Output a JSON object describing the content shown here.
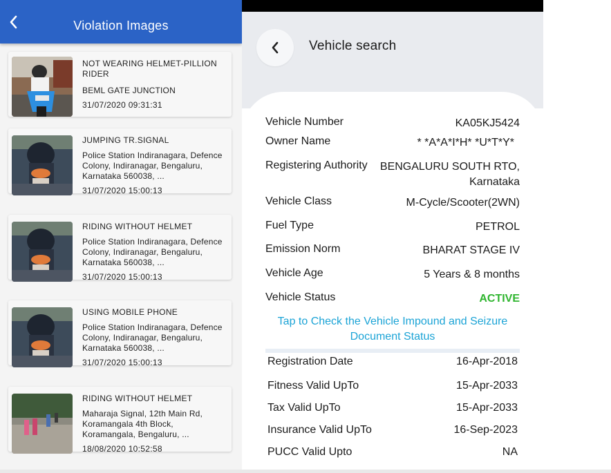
{
  "left_panel": {
    "title": "Violation Images",
    "violations": [
      {
        "type": "NOT WEARING HELMET-PILLION RIDER",
        "location": "BEML GATE JUNCTION",
        "time": "31/07/2020 09:31:31",
        "photo": "scooter-blue"
      },
      {
        "type": "JUMPING TR.SIGNAL",
        "location": "Police Station Indiranagara, Defence Colony, Indiranagar, Bengaluru, Karnataka 560038, ...",
        "time": "31/07/2020 15:00:13",
        "photo": "scooter-night"
      },
      {
        "type": "RIDING WITHOUT HELMET",
        "location": "Police Station Indiranagara, Defence Colony, Indiranagar, Bengaluru, Karnataka 560038, ...",
        "time": "31/07/2020 15:00:13",
        "photo": "scooter-night"
      },
      {
        "type": "USING MOBILE PHONE",
        "location": "Police Station Indiranagara, Defence Colony, Indiranagar, Bengaluru, Karnataka 560038, ...",
        "time": "31/07/2020 15:00:13",
        "photo": "scooter-night"
      },
      {
        "type": "RIDING WITHOUT HELMET",
        "location": "Maharaja Signal, 12th Main Rd, Koramangala 4th Block, Koramangala, Bengaluru, ...",
        "time": "18/08/2020 10:52:58",
        "photo": "street"
      }
    ]
  },
  "vehicle_search": {
    "title": "Vehicle search",
    "details": [
      {
        "label": "Vehicle Number",
        "value": "KA05KJ5424"
      },
      {
        "label": "Owner Name",
        "value": "*  *A*A*I*H*  *U*T*Y*"
      },
      {
        "label": "Registering Authority",
        "value_line1": "BENGALURU SOUTH  RTO,",
        "value_line2": "Karnataka"
      },
      {
        "label": "Vehicle Class",
        "value": "M-Cycle/Scooter(2WN)"
      },
      {
        "label": "Fuel Type",
        "value": "PETROL"
      },
      {
        "label": "Emission Norm",
        "value": "BHARAT STAGE IV"
      },
      {
        "label": "Vehicle Age",
        "value": "5 Years  & 8 months"
      },
      {
        "label": "Vehicle Status",
        "value": "ACTIVE"
      }
    ],
    "impound_link_line1": "Tap to Check the Vehicle Impound and Seizure",
    "impound_link_line2": "Document Status",
    "validity": [
      {
        "label": "Registration Date",
        "value": "16-Apr-2018"
      },
      {
        "label": "Fitness Valid UpTo",
        "value": "15-Apr-2033"
      },
      {
        "label": "Tax Valid UpTo",
        "value": "15-Apr-2033"
      },
      {
        "label": "Insurance Valid UpTo",
        "value": "16-Sep-2023"
      },
      {
        "label": "PUCC Valid Upto",
        "value": "NA"
      }
    ]
  },
  "colors": {
    "appbar": "#2b63c6",
    "active_status": "#2fb52f",
    "link": "#1aa3d6"
  },
  "icons": {
    "left_back": "chevron-left-icon",
    "right_back": "chevron-left-icon"
  }
}
